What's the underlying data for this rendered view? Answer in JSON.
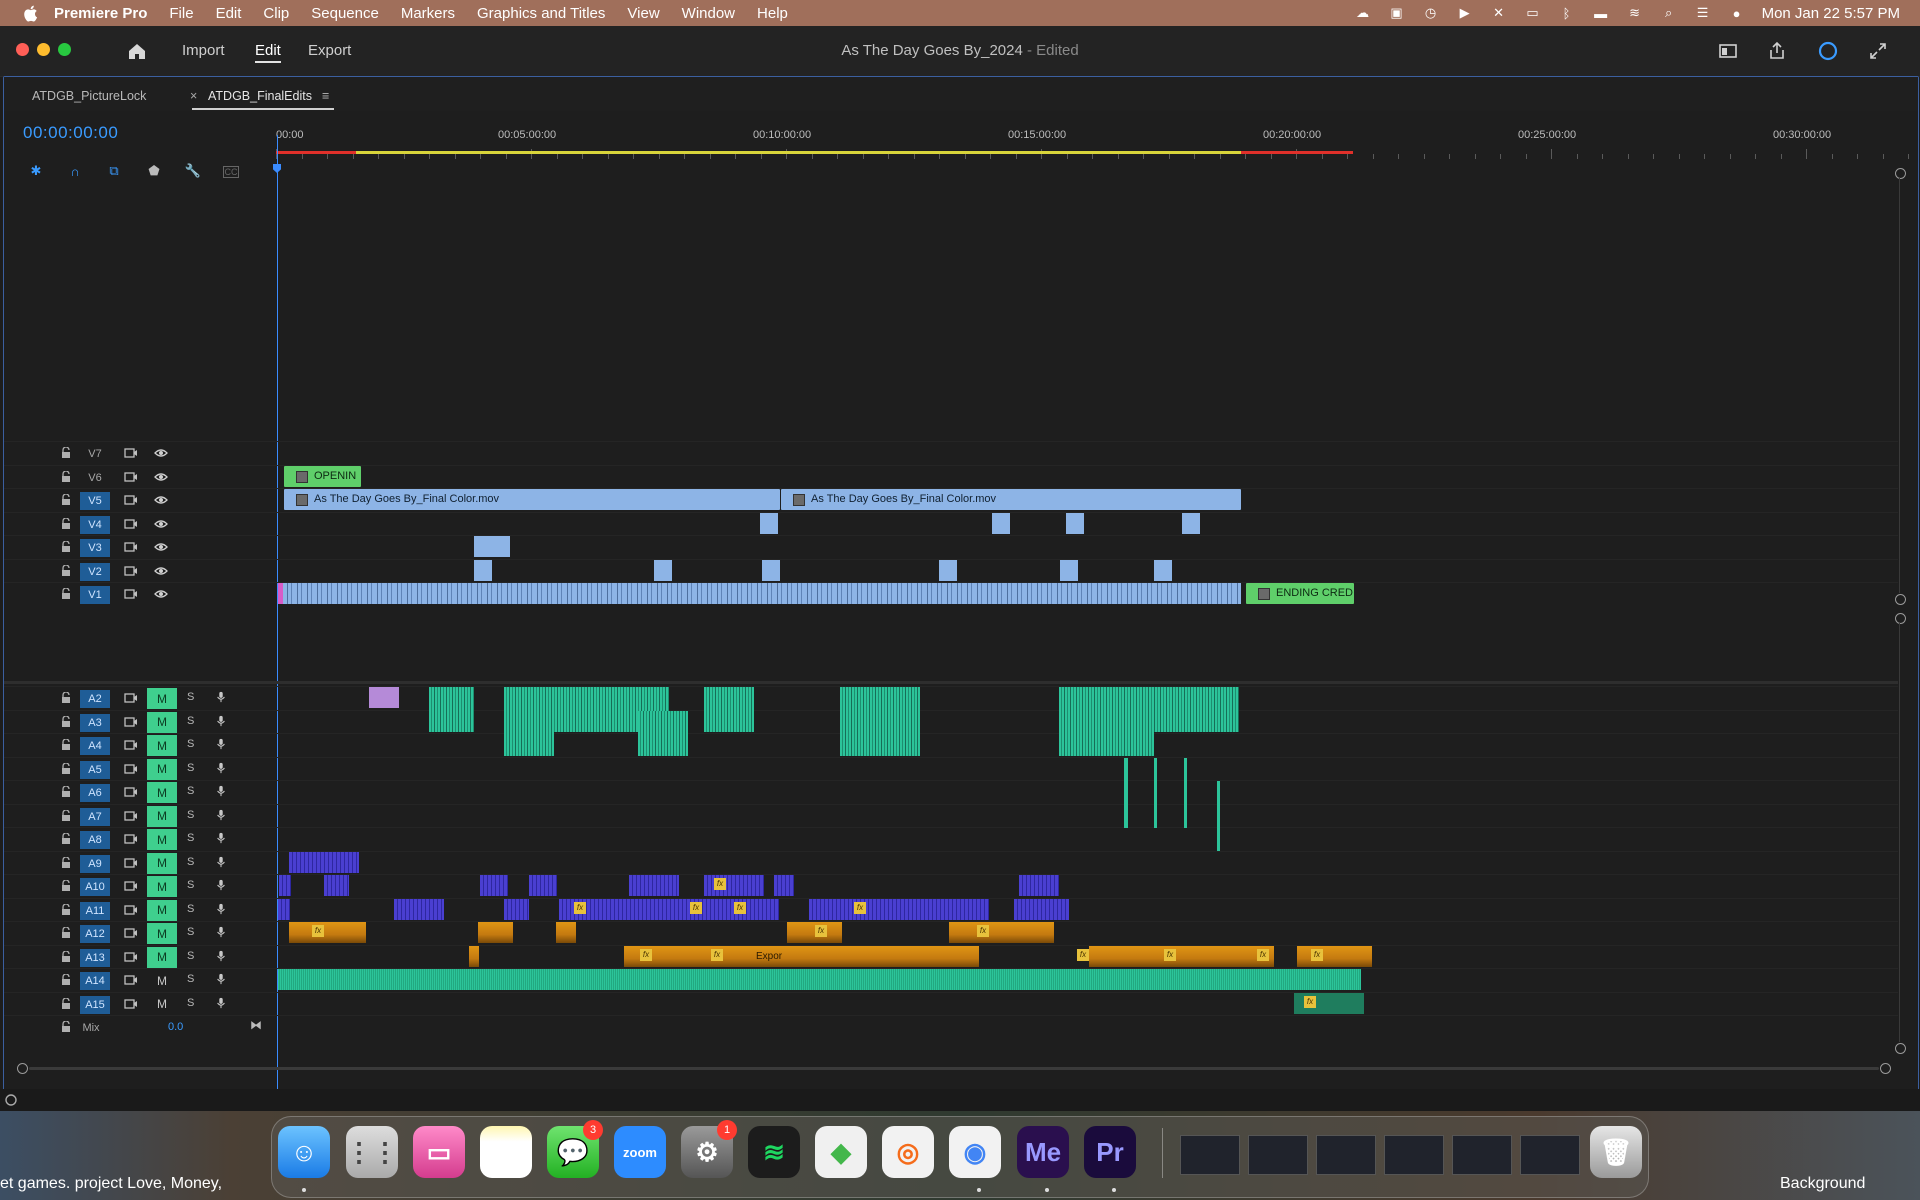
{
  "menubar": {
    "app_name": "Premiere Pro",
    "items": [
      "File",
      "Edit",
      "Clip",
      "Sequence",
      "Markers",
      "Graphics and Titles",
      "View",
      "Window",
      "Help"
    ],
    "datetime": "Mon Jan 22  5:57 PM"
  },
  "titlebar": {
    "workspaces": [
      "Import",
      "Edit",
      "Export"
    ],
    "active_workspace": "Edit",
    "doc_title": "As The Day Goes By_2024",
    "doc_status": " - Edited"
  },
  "tabs": [
    {
      "label": "ATDGB_PictureLock",
      "active": false
    },
    {
      "label": "ATDGB_FinalEdits",
      "active": true
    }
  ],
  "timeline": {
    "timecode": "00:00:00:00",
    "ruler_labels": [
      "00:00",
      "00:05:00:00",
      "00:10:00:00",
      "00:15:00:00",
      "00:20:00:00",
      "00:25:00:00",
      "00:30:00:00"
    ],
    "video_tracks": [
      {
        "name": "V7",
        "targeted": false
      },
      {
        "name": "V6",
        "targeted": false
      },
      {
        "name": "V5",
        "targeted": true
      },
      {
        "name": "V4",
        "targeted": true
      },
      {
        "name": "V3",
        "targeted": true
      },
      {
        "name": "V2",
        "targeted": true
      },
      {
        "name": "V1",
        "targeted": true
      }
    ],
    "audio_tracks": [
      {
        "name": "A2",
        "m": "M",
        "s": "S",
        "muted": true
      },
      {
        "name": "A3",
        "m": "M",
        "s": "S",
        "muted": true
      },
      {
        "name": "A4",
        "m": "M",
        "s": "S",
        "muted": true
      },
      {
        "name": "A5",
        "m": "M",
        "s": "S",
        "muted": true
      },
      {
        "name": "A6",
        "m": "M",
        "s": "S",
        "muted": true
      },
      {
        "name": "A7",
        "m": "M",
        "s": "S",
        "muted": true
      },
      {
        "name": "A8",
        "m": "M",
        "s": "S",
        "muted": true
      },
      {
        "name": "A9",
        "m": "M",
        "s": "S",
        "muted": true
      },
      {
        "name": "A10",
        "m": "M",
        "s": "S",
        "muted": true
      },
      {
        "name": "A11",
        "m": "M",
        "s": "S",
        "muted": true
      },
      {
        "name": "A12",
        "m": "M",
        "s": "S",
        "muted": true
      },
      {
        "name": "A13",
        "m": "M",
        "s": "S",
        "muted": true
      },
      {
        "name": "A14",
        "m": "M",
        "s": "S",
        "muted": false
      },
      {
        "name": "A15",
        "m": "M",
        "s": "S",
        "muted": false
      }
    ],
    "mix": {
      "label": "Mix",
      "value": "0.0"
    },
    "clips": {
      "opening": "OPENIN",
      "final_color_1": "As The Day Goes By_Final Color.mov",
      "final_color_2": "As The Day Goes By_Final Color.mov",
      "ending": "ENDING CREDI",
      "a13_export": "Expor",
      "fx_label": "fx"
    },
    "colors": {
      "accent": "#3a9bff",
      "video_clip": "#8db4e6",
      "green_title": "#5fcf6a",
      "audio_green": "#2cc49a",
      "audio_purple": "#4a3fd1",
      "audio_orange": "#d88a12"
    }
  },
  "dock": {
    "apps": [
      {
        "name": "Finder",
        "icon": "finder-icon"
      },
      {
        "name": "Launchpad",
        "icon": "launchpad-icon"
      },
      {
        "name": "CleanMyMac",
        "icon": "cleanmymac-icon"
      },
      {
        "name": "Notes",
        "icon": "notes-icon"
      },
      {
        "name": "Messages",
        "icon": "messages-icon",
        "badge": "3"
      },
      {
        "name": "Zoom",
        "icon": "zoom-icon",
        "label": "zoom"
      },
      {
        "name": "System Settings",
        "icon": "settings-icon",
        "badge": "1"
      },
      {
        "name": "Spotify",
        "icon": "spotify-icon"
      },
      {
        "name": "The Sims",
        "icon": "sims-icon"
      },
      {
        "name": "Origin",
        "icon": "origin-icon"
      },
      {
        "name": "Chrome",
        "icon": "chrome-icon"
      },
      {
        "name": "Media Encoder",
        "icon": "media-encoder-icon",
        "label": "Me"
      },
      {
        "name": "Premiere Pro",
        "icon": "premiere-icon",
        "label": "Pr"
      },
      {
        "name": "Trash",
        "icon": "trash-icon"
      }
    ],
    "desktop_left_text": "et games.  project Love, Money, ",
    "desktop_right_text": "Background"
  }
}
